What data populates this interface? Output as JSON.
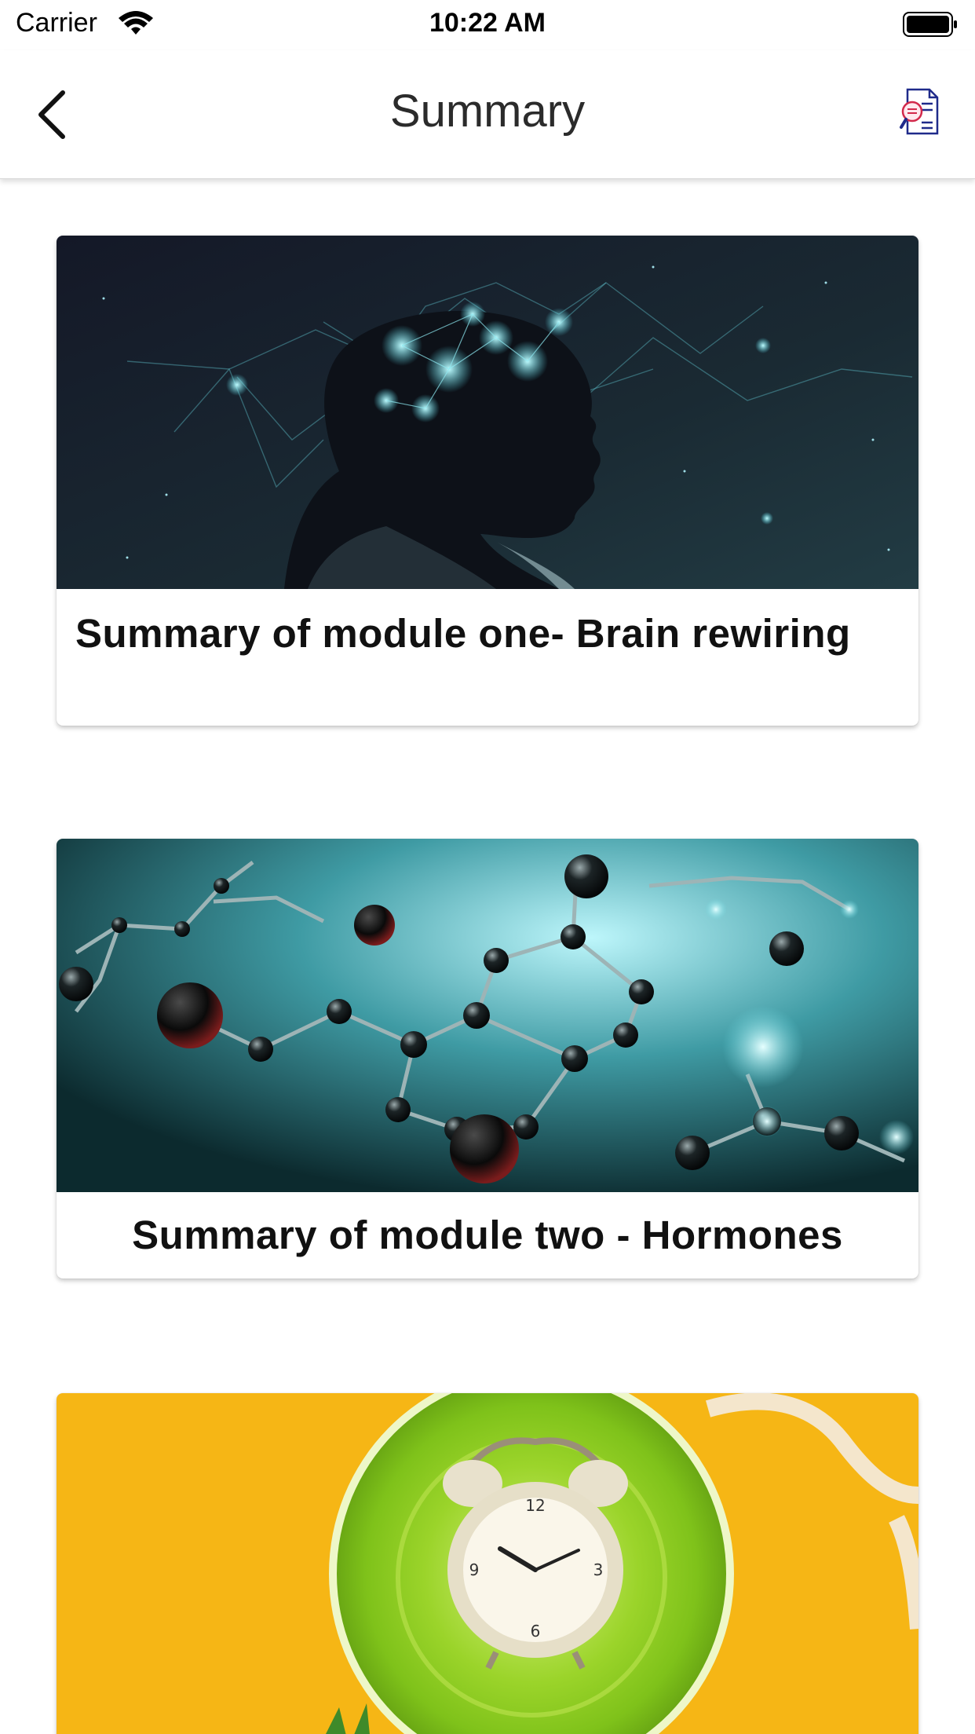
{
  "status_bar": {
    "carrier": "Carrier",
    "time": "10:22 AM"
  },
  "nav": {
    "title": "Summary",
    "back_icon": "chevron-left-icon",
    "action_icon": "document-search-icon"
  },
  "cards": [
    {
      "title": "Summary of module one- Brain rewiring",
      "image": "brain-network-image"
    },
    {
      "title": "Summary of module two - Hormones",
      "image": "molecule-image"
    },
    {
      "title": "",
      "image": "clock-plate-image"
    }
  ],
  "colors": {
    "accent_doc_icon": "#1f2a8a",
    "doc_icon_highlight": "#d2294b"
  }
}
